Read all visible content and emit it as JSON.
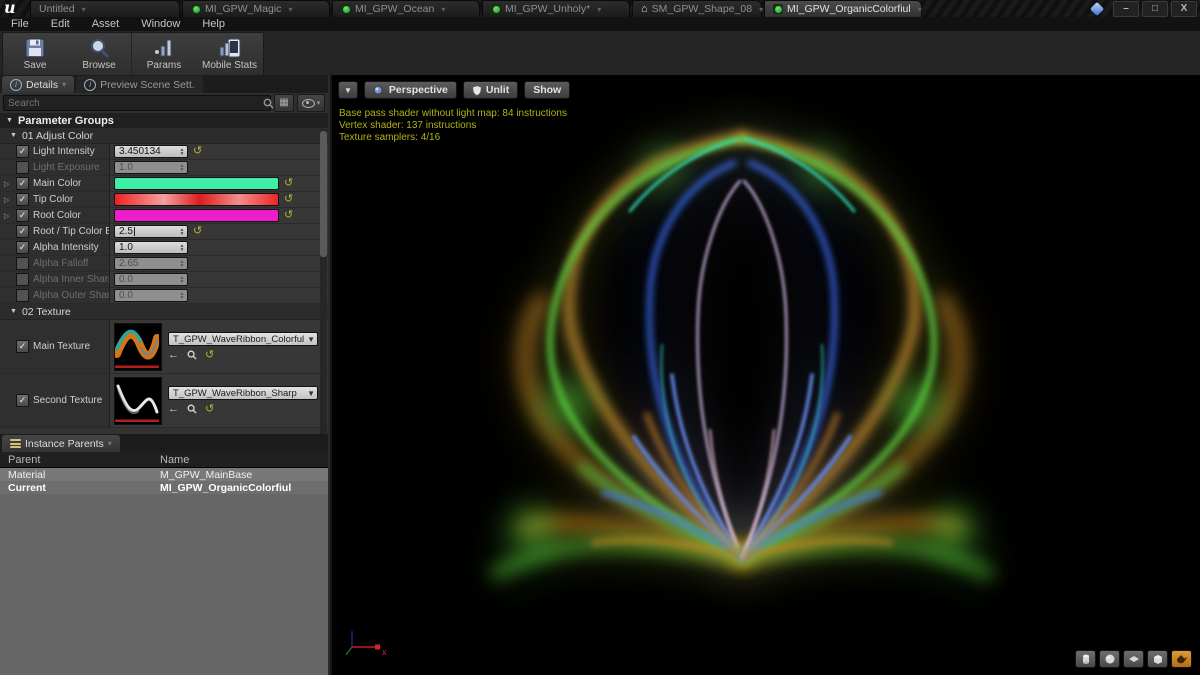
{
  "window": {
    "logo": "u",
    "controls": {
      "minimize": "–",
      "maximize": "□",
      "close": "X"
    }
  },
  "titlebar": {
    "tabs": [
      {
        "label": "Untitled",
        "icon": "none"
      },
      {
        "label": "MI_GPW_Magic",
        "icon": "material-instance"
      },
      {
        "label": "MI_GPW_Ocean",
        "icon": "material-instance"
      },
      {
        "label": "MI_GPW_Unholy*",
        "icon": "material-instance"
      },
      {
        "label": "SM_GPW_Shape_08",
        "icon": "static-mesh"
      },
      {
        "label": "MI_GPW_OrganicColorfiul",
        "icon": "material-instance"
      }
    ]
  },
  "menu": [
    "File",
    "Edit",
    "Asset",
    "Window",
    "Help"
  ],
  "toolbar": {
    "save": "Save",
    "browse": "Browse",
    "params": "Params",
    "mobile_stats": "Mobile Stats"
  },
  "details": {
    "tabs": {
      "details": "Details",
      "preview": "Preview Scene Sett."
    },
    "search": {
      "placeholder": "Search"
    },
    "header": "Parameter Groups",
    "groups": [
      {
        "label": "01 Adjust Color"
      },
      {
        "label": "02 Texture"
      }
    ],
    "params": [
      {
        "label": "Light Intensity",
        "value": "3.450134",
        "enabled": true,
        "reset": true
      },
      {
        "label": "Light Exposure",
        "value": "1.0",
        "enabled": false
      },
      {
        "label": "Main Color",
        "enabled": true,
        "reset": true
      },
      {
        "label": "Tip Color",
        "enabled": true,
        "reset": true
      },
      {
        "label": "Root Color",
        "enabled": true,
        "reset": true
      },
      {
        "label": "Root / Tip Color Blend",
        "value": "2.5",
        "enabled": true,
        "reset": true
      },
      {
        "label": "Alpha Intensity",
        "value": "1.0",
        "enabled": true
      },
      {
        "label": "Alpha Falloff",
        "value": "2.65",
        "enabled": false
      },
      {
        "label": "Alpha Inner Sharper",
        "value": "0.0",
        "enabled": false
      },
      {
        "label": "Alpha Outer Sharper",
        "value": "0.0",
        "enabled": false
      }
    ],
    "textures": [
      {
        "label": "Main Texture",
        "asset": "T_GPW_WaveRibbon_Colorful"
      },
      {
        "label": "Second Texture",
        "asset": "T_GPW_WaveRibbon_Sharp"
      }
    ]
  },
  "instance_parents": {
    "tab": "Instance Parents",
    "col_parent": "Parent",
    "col_name": "Name",
    "rows": [
      {
        "parent": "Material",
        "name": "M_GPW_MainBase"
      },
      {
        "parent": "Current",
        "name": "MI_GPW_OrganicColorfiul"
      }
    ]
  },
  "viewport": {
    "view_mode_label": "Perspective",
    "lit_mode_label": "Unlit",
    "show_label": "Show",
    "stats": [
      "Base pass shader without light map: 84 instructions",
      "Vertex shader: 137 instructions",
      "Texture samplers: 4/16"
    ],
    "axis_label": "x"
  },
  "colors": {
    "main_color": "#3deea6",
    "tip_color_css": "linear-gradient(90deg,#ee2222,#f5a0a0 30%,#dd1d1d 52%,#f28d8d 76%,#ee2525)",
    "root_color": "#ee1ccb",
    "stats_text": "#b2b216",
    "mesh_active": "#c87f1e"
  }
}
